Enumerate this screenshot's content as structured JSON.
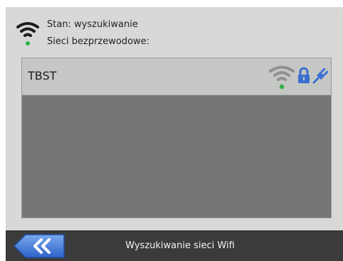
{
  "status": {
    "label": "Stan: wyszukiwanie",
    "networks_label": "Sieci bezprzewodowe:",
    "icon": "wifi-status-icon"
  },
  "networks": [
    {
      "ssid": "TBST",
      "icons": [
        "wifi-signal-icon",
        "lock-icon",
        "connect-plug-icon"
      ]
    }
  ],
  "bottom_bar": {
    "title": "Wyszukiwanie sieci Wifi",
    "back_icon": "double-chevron-left-icon"
  },
  "colors": {
    "accent": "#3a6fd0",
    "signal_dot": "#2db34a",
    "panel_bg": "#d8d8d6",
    "list_bg": "#767677"
  }
}
